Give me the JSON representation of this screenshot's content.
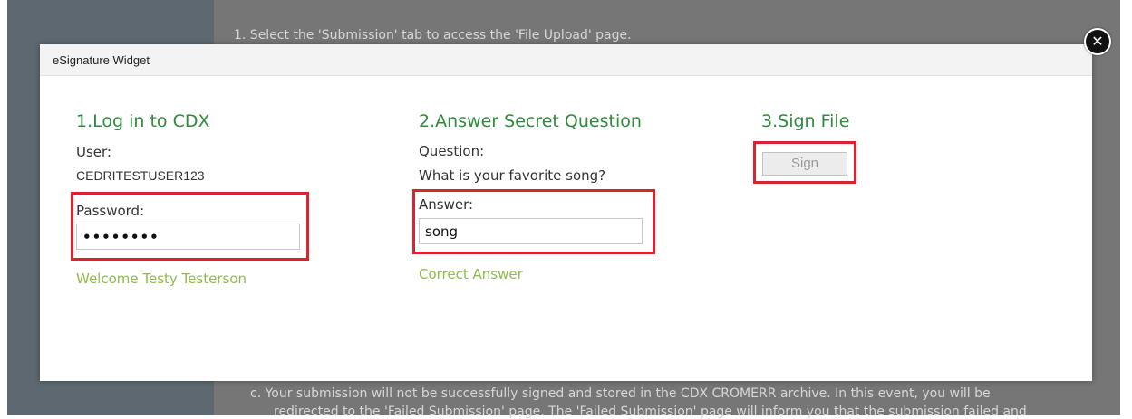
{
  "background": {
    "top_line": "1.  Select the 'Submission' tab to access the 'File Upload' page.",
    "bottom_line_1": "c.  Your submission will not be successfully signed and stored in the CDX CROMERR archive. In this event, you will be",
    "bottom_line_2": "redirected to the 'Failed Submission' page. The 'Failed Submission' page will inform you that the submission failed and"
  },
  "modal": {
    "title": "eSignature Widget",
    "close_icon": "close-icon",
    "close_glyph": "✕"
  },
  "login": {
    "heading": "1.Log in to CDX",
    "user_label": "User:",
    "user_value": "CEDRITESTUSER123",
    "password_label": "Password:",
    "password_value": "••••••••",
    "welcome": "Welcome Testy Testerson"
  },
  "question": {
    "heading": "2.Answer Secret Question",
    "question_label": "Question:",
    "question_text": "What is your favorite song?",
    "answer_label": "Answer:",
    "answer_value": "song",
    "status": "Correct Answer"
  },
  "sign": {
    "heading": "3.Sign File",
    "button_label": "Sign"
  },
  "colors": {
    "heading_green": "#2e8b3d",
    "status_green": "#8fbc4a",
    "highlight_red": "#d9232e"
  }
}
